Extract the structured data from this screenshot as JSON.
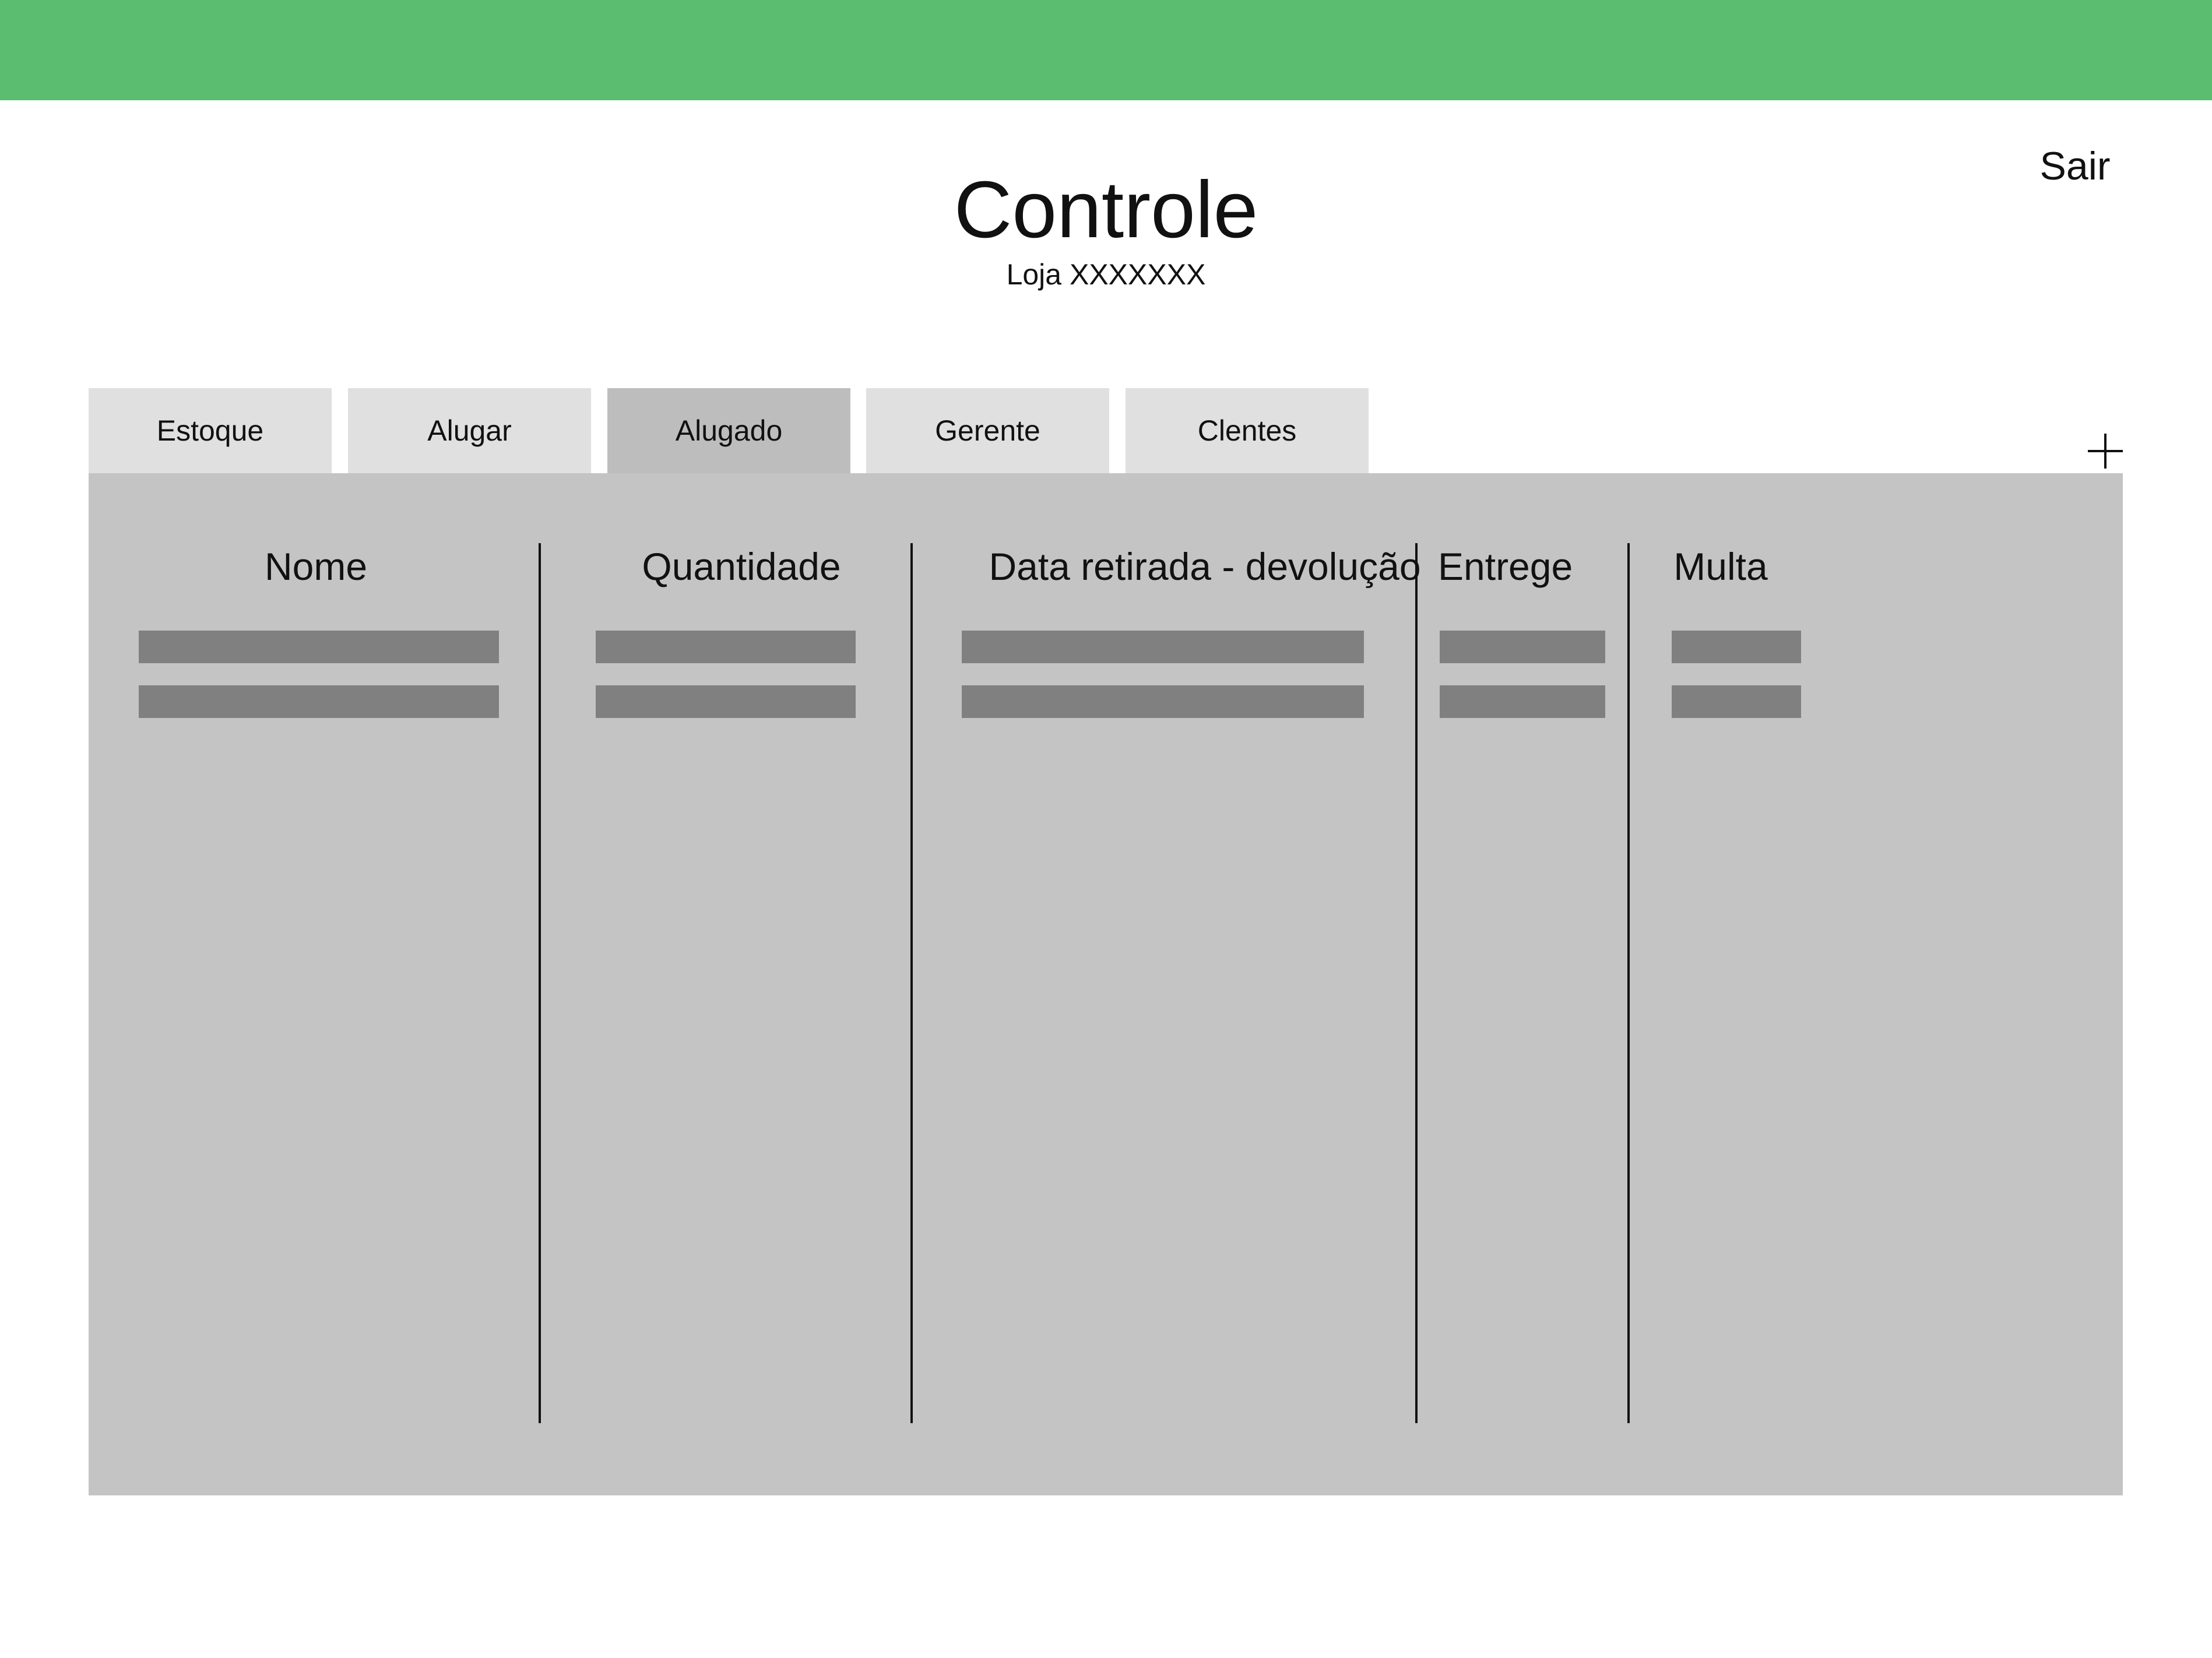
{
  "header": {
    "title": "Controle",
    "subtitle": "Loja XXXXXXX",
    "logout_label": "Sair",
    "accent_color": "#5bbd70"
  },
  "tabs": [
    {
      "label": "Estoque",
      "active": false
    },
    {
      "label": "Alugar",
      "active": false
    },
    {
      "label": "Alugado",
      "active": true
    },
    {
      "label": "Gerente",
      "active": false
    },
    {
      "label": "Clentes",
      "active": false
    }
  ],
  "toolbar": {
    "add_icon": "plus-icon"
  },
  "table": {
    "columns": [
      "Nome",
      "Quantidade",
      "Data retirada - devolução",
      "Entrege",
      "Multa"
    ]
  }
}
